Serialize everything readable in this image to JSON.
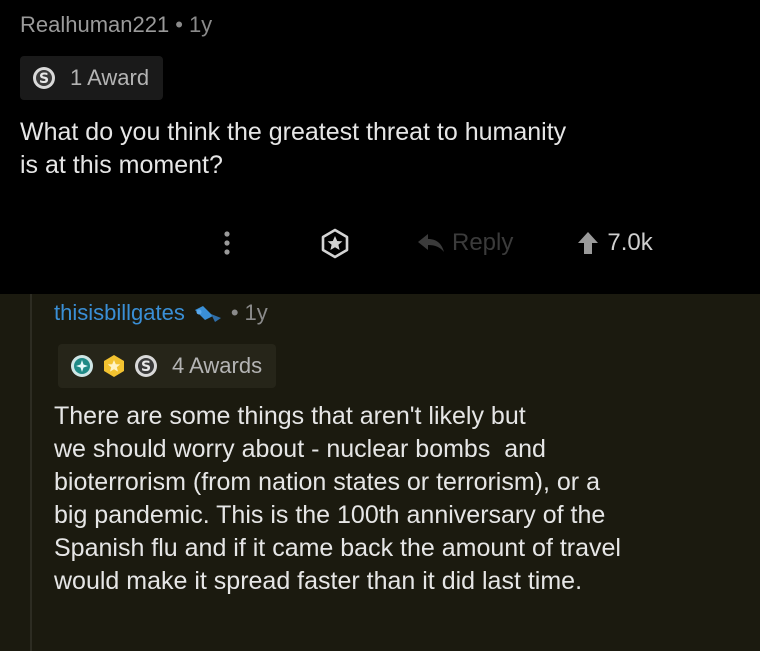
{
  "parent_comment": {
    "username": "Realhuman221",
    "separator": "•",
    "age": "1y",
    "award_count_label": "1 Award",
    "text_lines": [
      "What do you think the greatest threat to humanity",
      "is at this moment?"
    ],
    "actions": {
      "more_icon": "vertical-dots-icon",
      "award_icon": "award-star-icon",
      "reply_label": "Reply",
      "score": "7.0k"
    }
  },
  "reply_comment": {
    "username": "thisisbillgates",
    "separator": "•",
    "age": "1y",
    "award_count_label": "4 Awards",
    "text_lines": [
      "There are some things that aren't likely but",
      "we should worry about - nuclear bombs  and",
      "bioterrorism (from nation states or terrorism), or a",
      "big pandemic. This is the 100th anniversary of the",
      "Spanish flu and if it came back the amount of travel",
      "would make it spread faster than it did last time."
    ]
  },
  "colors": {
    "op_blue": "#3a8fd6",
    "reply_background": "#1b1a0f",
    "parent_background": "#000000"
  }
}
